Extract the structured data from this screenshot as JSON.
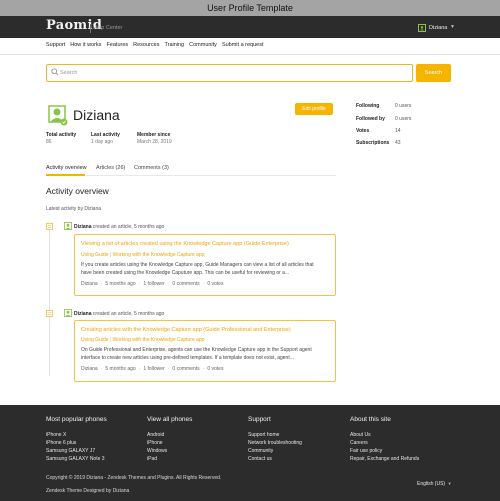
{
  "window_title": "User Profile Template",
  "header": {
    "logo": "Paomid",
    "help_center": "Help Center",
    "username": "Diziana"
  },
  "nav": [
    "Support",
    "How it works",
    "Features",
    "Resources",
    "Training",
    "Community",
    "Submit a request"
  ],
  "search": {
    "placeholder": "Search",
    "button": "Search"
  },
  "profile": {
    "name": "Diziana",
    "edit_button": "Edit profile",
    "stats": [
      {
        "label": "Total activity",
        "value": "86"
      },
      {
        "label": "Last activity",
        "value": "1 day ago"
      },
      {
        "label": "Member since",
        "value": "March 28, 2019"
      }
    ],
    "side_stats": [
      {
        "label": "Following",
        "value": "0 users"
      },
      {
        "label": "Followed by",
        "value": "0 users"
      },
      {
        "label": "Votes",
        "value": "14"
      },
      {
        "label": "Subscriptions",
        "value": "43"
      }
    ]
  },
  "tabs": [
    "Activity overview",
    "Articles (26)",
    "Comments (3)"
  ],
  "section_title": "Activity overview",
  "latest_activity": "Latest activity by Diziana",
  "activities": [
    {
      "author": "Diziana",
      "action": "created an article, 5 months ago",
      "title": "Viewing a list of articles created using the Knowledge Capture app (Guide Enterprise)",
      "crumbs": [
        "Using Guide",
        "Working with the Knowledge Capture app"
      ],
      "body_line1": "If you create articles using the Knowledge Capture app, Guide Managers can view a list of all articles that",
      "body_line2": "have been created using the Knowledge Caputure app. This can be useful for reviewing or a...",
      "meta": [
        "Diziana",
        "5 months ago",
        "1 follower",
        "0 comments",
        "0 votes"
      ]
    },
    {
      "author": "Diziana",
      "action": "created an article, 5 months ago",
      "title": "Creating articles with the Knowledge Capture app (Guide Professional and Enterprise)",
      "crumbs": [
        "Using Guide",
        "Working with the Knowledge Capture app"
      ],
      "body_line1": "On Guide Professional and Enterprise, agents can use the Knowledge Capture app in the Support agent",
      "body_line2": "interface to create new articles using pre-defined templates. If a template does not exist, agent...",
      "meta": [
        "Diziana",
        "5 months ago",
        "1 follower",
        "0 comments",
        "0 votes"
      ]
    }
  ],
  "footer": {
    "columns": [
      {
        "heading": "Most popular phones",
        "links": [
          "iPhone X",
          "iPhone 6 plus",
          "Samsung GALAXY J7",
          "Samsung GALAXY Note 3"
        ]
      },
      {
        "heading": "View all phones",
        "links": [
          "Android",
          "iPhone",
          "Windows",
          "iPad"
        ]
      },
      {
        "heading": "Support",
        "links": [
          "Support home",
          "Network troubleshooting",
          "Community",
          "Contact us"
        ]
      },
      {
        "heading": "About this site",
        "links": [
          "About Us",
          "Careers",
          "Fair use policy",
          "Repair, Exchange and Refunds"
        ]
      }
    ],
    "copyright": "Copyright © 2019 Diziana - Zendesk Themes and Plugins. All Rights Reserved.",
    "designed_by": "Zendesk Theme Designed by Diziana",
    "language": "English (US)"
  },
  "colors": {
    "accent": "#f5b400",
    "avatar_green": "#8bc34a",
    "dark": "#2c2c2c"
  }
}
